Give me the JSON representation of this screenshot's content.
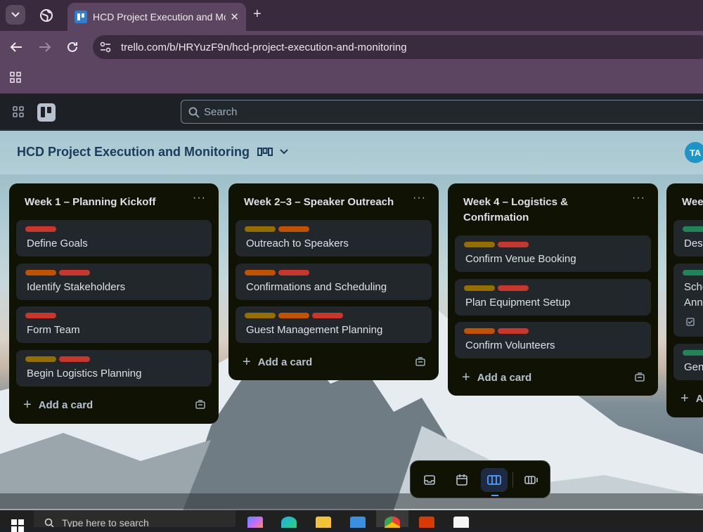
{
  "browser": {
    "tab_title": "HCD Project Execution and Mon",
    "url": "trello.com/b/HRYuzF9n/hcd-project-execution-and-monitoring"
  },
  "trello": {
    "search_placeholder": "Search",
    "board_title": "HCD Project Execution and Monitoring",
    "avatar_initials": "TA"
  },
  "lists": [
    {
      "title": "Week 1 – Planning Kickoff",
      "cards": [
        {
          "title": "Define Goals",
          "labels": [
            "red"
          ]
        },
        {
          "title": "Identify Stakeholders",
          "labels": [
            "orange",
            "red"
          ]
        },
        {
          "title": "Form Team",
          "labels": [
            "red"
          ]
        },
        {
          "title": "Begin Logistics Planning",
          "labels": [
            "yellow",
            "red"
          ]
        }
      ],
      "add_card": "Add a card"
    },
    {
      "title": "Week 2–3 – Speaker Outreach",
      "cards": [
        {
          "title": "Outreach to Speakers",
          "labels": [
            "yellow",
            "orange"
          ]
        },
        {
          "title": "Confirmations and Scheduling",
          "labels": [
            "orange",
            "red"
          ]
        },
        {
          "title": "Guest Management Planning",
          "labels": [
            "yellow",
            "orange",
            "red"
          ]
        }
      ],
      "add_card": "Add a card"
    },
    {
      "title_line1": "Week 4 – Logistics &",
      "title_line2": "Confirmation",
      "cards": [
        {
          "title": "Confirm Venue Booking",
          "labels": [
            "yellow",
            "red"
          ]
        },
        {
          "title": "Plan Equipment Setup",
          "labels": [
            "yellow",
            "red"
          ]
        },
        {
          "title": "Confirm Volunteers",
          "labels": [
            "orange",
            "red"
          ]
        }
      ],
      "add_card": "Add a card"
    },
    {
      "title": "Wee",
      "cards": [
        {
          "title": "Des"
        },
        {
          "title_line1": "Sche",
          "title_line2": "Ann"
        },
        {
          "title": "Gen"
        }
      ],
      "add_card": "A"
    }
  ],
  "label_colors": {
    "red": "#c9372c",
    "orange": "#c25100",
    "yellow": "#946f00",
    "green": "#1f845a"
  },
  "view_switcher": {
    "items": [
      "inbox-icon",
      "calendar-icon",
      "board-icon",
      "switch-boards-icon"
    ],
    "active": "board-icon"
  },
  "taskbar": {
    "search_placeholder": "Type here to search"
  }
}
